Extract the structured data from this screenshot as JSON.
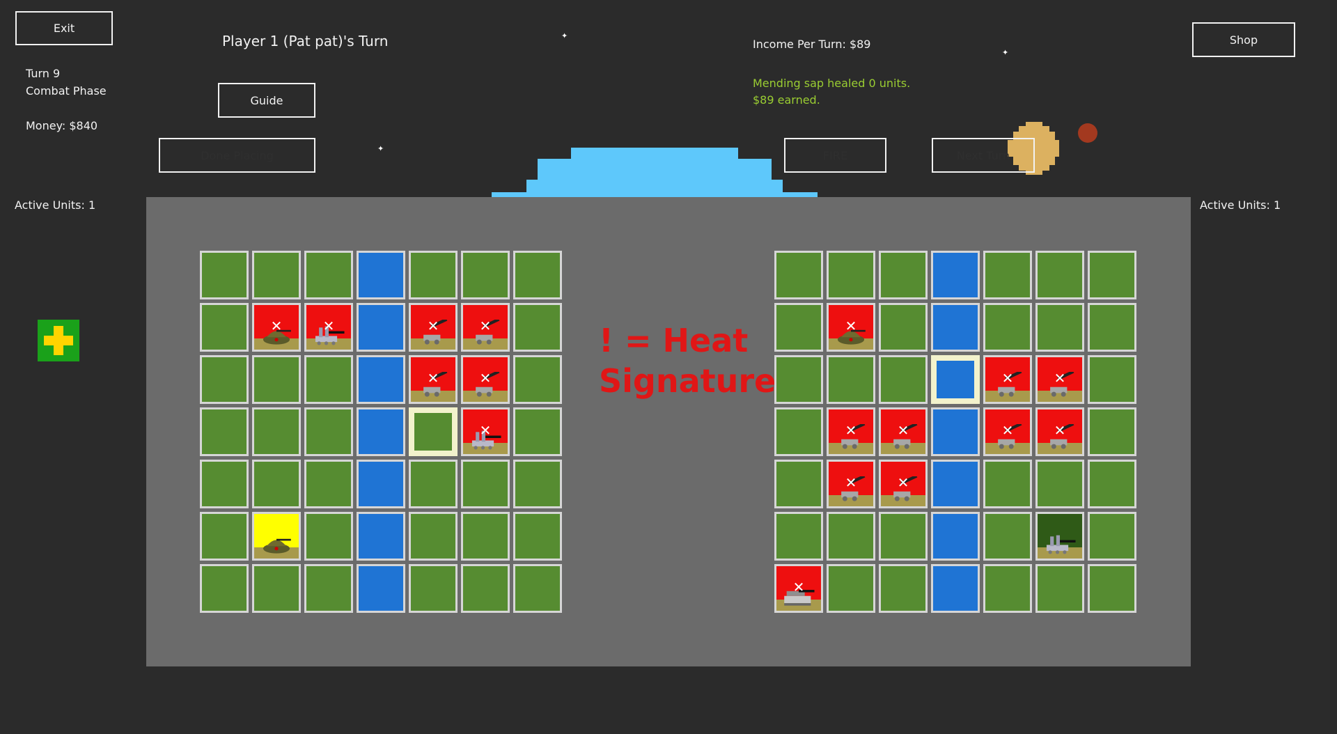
{
  "buttons": {
    "exit": "Exit",
    "guide": "Guide",
    "done_placing": "Done Placing",
    "fire": "FIRE",
    "next_turn": "Next Turn",
    "shop": "Shop"
  },
  "header": {
    "turn_title": "Player 1 (Pat pat)'s Turn",
    "turn": "Turn 9",
    "phase": "Combat Phase",
    "money": "Money: $840",
    "income": "Income Per Turn: $89",
    "message_line1": "Mending sap healed 0 units.",
    "message_line2": "$89 earned."
  },
  "left_panel": {
    "active_units": "Active Units: 1",
    "heal_icon": "plus-icon"
  },
  "right_panel": {
    "active_units": "Active Units: 1"
  },
  "legend": {
    "line1": "! = Heat",
    "line2": "Signature"
  },
  "colors": {
    "background": "#2b2b2b",
    "board": "#6b6b6b",
    "grass": "#568c31",
    "water": "#1f74d4",
    "hit": "#ee0f0f",
    "selected": "#ffff00",
    "message": "#9acd32",
    "legend": "#e01616",
    "sky": "#5ec8fb",
    "sun": "#dcb160"
  },
  "grid_legend": {
    "g": "grass",
    "w": "water",
    "h": "highlighted",
    "T": "tank-hit",
    "A": "artillery-hit",
    "C": "cannon-hit",
    "Y": "tank-selected",
    "E": "artillery-enemy",
    "B": "battery-hit"
  },
  "player_grid": [
    "gggwggg",
    "gTAwCCg",
    "gggwCCg",
    "gggwhAg",
    "gggwggg",
    "gYgwggg",
    "gggwggg"
  ],
  "enemy_grid": [
    "gggwggg",
    "gTgwggg",
    "gggHCCg",
    "gCCwCCg",
    "gCCwggg",
    "gggwgEg",
    "Bggwggg"
  ]
}
